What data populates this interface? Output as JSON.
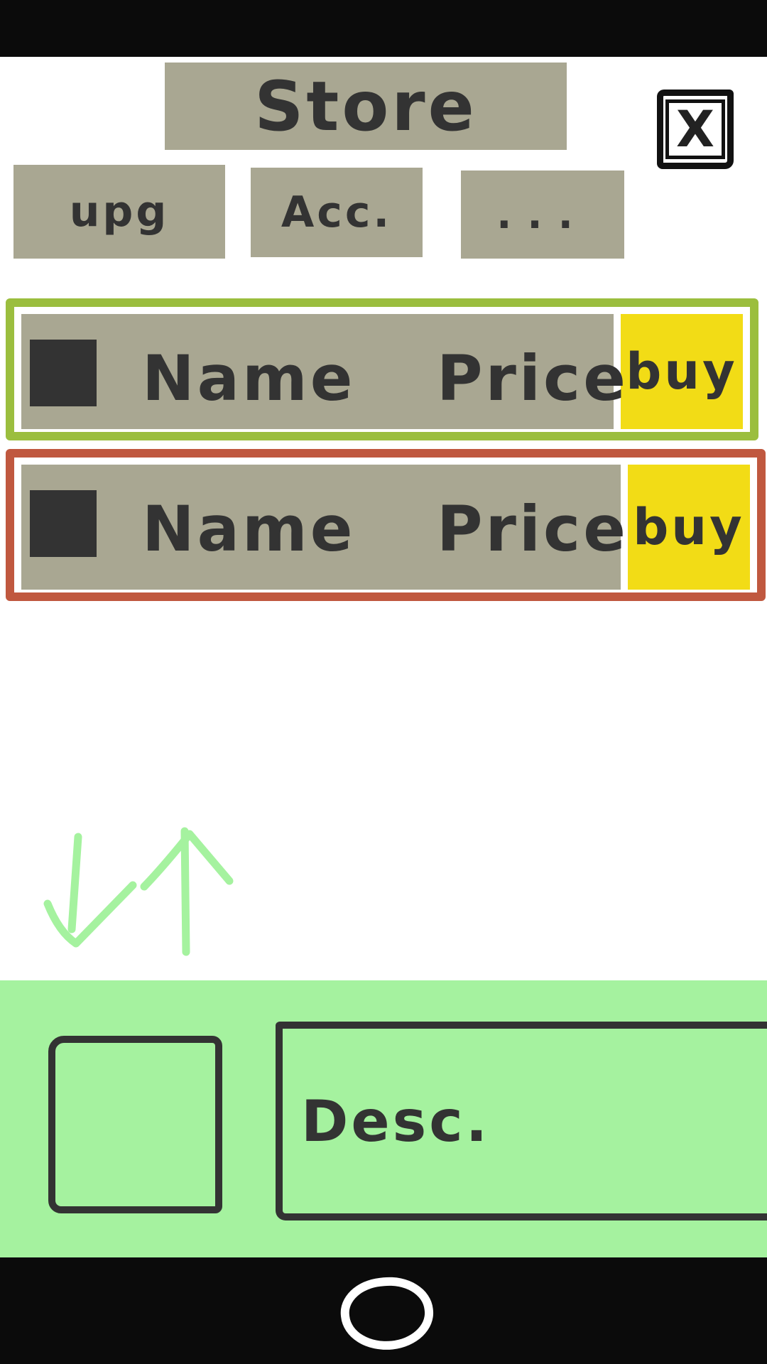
{
  "header": {
    "title": "Store",
    "close_label": "X"
  },
  "tabs": [
    {
      "label": "upg"
    },
    {
      "label": "Acc."
    },
    {
      "label": "..."
    }
  ],
  "items": [
    {
      "name": "Name",
      "price": "Price",
      "buy_label": "buy",
      "highlight": "#9bbe3e"
    },
    {
      "name": "Name",
      "price": "Price",
      "buy_label": "buy",
      "highlight": "#c0583f"
    }
  ],
  "detail": {
    "description": "Desc."
  },
  "icons": {
    "close": "close-icon",
    "scroll_arrows": "swap-arrows-icon",
    "home": "home-button-icon"
  },
  "colors": {
    "gray_block": "#a9a792",
    "selected_row": "#9bbe3e",
    "alert_row": "#c0583f",
    "buy_button": "#f2dc16",
    "detail_panel": "#a5f29f"
  }
}
